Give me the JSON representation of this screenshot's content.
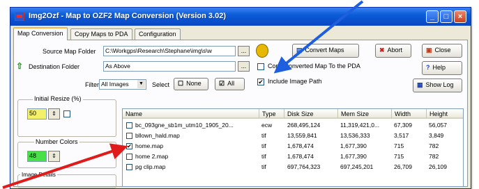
{
  "window": {
    "title": "Img2Ozf - Map to OZF2 Map Conversion (Version 3.02)",
    "controls": [
      "_",
      "□",
      "×"
    ]
  },
  "tabs": [
    "Map Conversion",
    "Copy Maps to PDA",
    "Configuration"
  ],
  "form": {
    "source_label": "Source Map Folder",
    "source_value": "C:\\Workgps\\Research\\Stephane\\img\\s\\w",
    "dest_label": "Destination Folder",
    "dest_value": "As Above",
    "filter_label": "Filter",
    "filter_value": "All Images",
    "select_label": "Select",
    "none_button": "None",
    "all_button": "All",
    "browse_glyph": "..."
  },
  "options": {
    "copy_to_pda_label": "Copy Converted Map To the PDA",
    "copy_to_pda_checked": false,
    "include_path_label": "Include Image Path",
    "include_path_checked": true
  },
  "buttons": {
    "convert": "Convert Maps",
    "abort": "Abort",
    "close": "Close",
    "help": "Help",
    "showlog": "Show Log"
  },
  "left_panel": {
    "resize_title": "Initial Resize (%)",
    "resize_value": "50",
    "colors_title": "Number Colors",
    "colors_value": "48",
    "details_title": "Image Details"
  },
  "table": {
    "columns": [
      "Name",
      "Type",
      "Disk Size",
      "Mem Size",
      "Width",
      "Height"
    ],
    "rows": [
      {
        "checked": false,
        "name": "bc_093gne_sb1m_utm10_1905_20...",
        "type": "ecw",
        "disk": "268,495,124",
        "mem": "11,319,421,0...",
        "width": "67,309",
        "height": "56,057"
      },
      {
        "checked": false,
        "name": "bllown_hald.map",
        "type": "tif",
        "disk": "13,559,841",
        "mem": "13,536,333",
        "width": "3,517",
        "height": "3,849"
      },
      {
        "checked": true,
        "name": "home.map",
        "type": "tif",
        "disk": "1,678,474",
        "mem": "1,677,390",
        "width": "715",
        "height": "782"
      },
      {
        "checked": false,
        "name": "home 2.map",
        "type": "tif",
        "disk": "1,678,474",
        "mem": "1,677,390",
        "width": "715",
        "height": "782"
      },
      {
        "checked": false,
        "name": "pg clip.map",
        "type": "tif",
        "disk": "697,764,323",
        "mem": "697,245,201",
        "width": "26,709",
        "height": "26,109"
      }
    ]
  },
  "colors": {
    "titlebar": "#0a46c3",
    "arrow_blue": "#1e5fe0",
    "arrow_red": "#e01b1b",
    "resize_field": "#f3f06a",
    "colors_field": "#47e047"
  }
}
